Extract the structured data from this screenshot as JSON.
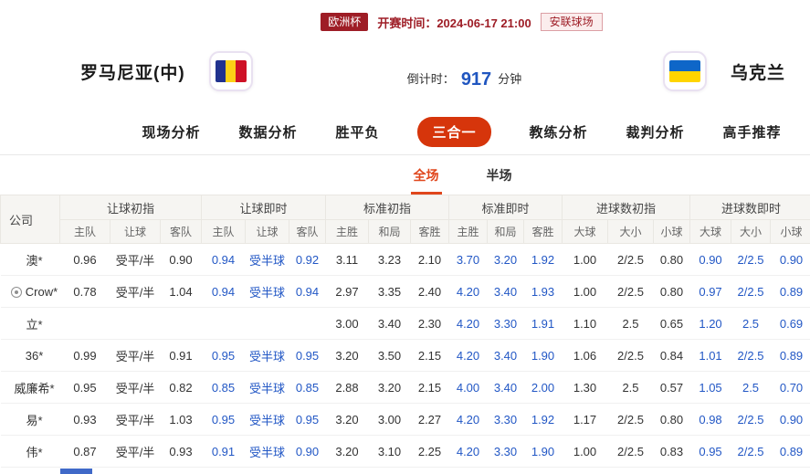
{
  "colors": {
    "accent": "#9e1d26",
    "tab_active": "#d6350b",
    "live_blue": "#2257c5",
    "countdown_blue": "#2056c0",
    "subtab_red": "#e0461c"
  },
  "header": {
    "league": "欧洲杯",
    "kickoff_label": "开赛时间：2024-06-17 21:00",
    "venue": "安联球场"
  },
  "teams": {
    "home": "罗马尼亚(中)",
    "away": "乌克兰",
    "home_flag": {
      "name": "romania-flag",
      "type": "vertical",
      "colors": [
        "#21328f",
        "#fcd116",
        "#ce1126"
      ]
    },
    "away_flag": {
      "name": "ukraine-flag",
      "type": "horizontal",
      "colors": [
        "#0e66c8",
        "#ffd500"
      ]
    },
    "countdown_label": "倒计时：",
    "countdown_value": "917",
    "countdown_unit": "分钟"
  },
  "nav": {
    "tabs": [
      {
        "name": "live-analysis",
        "label": "现场分析",
        "active": false
      },
      {
        "name": "data-analysis",
        "label": "数据分析",
        "active": false
      },
      {
        "name": "win-draw-loss",
        "label": "胜平负",
        "active": false
      },
      {
        "name": "three-in-one",
        "label": "三合一",
        "active": true
      },
      {
        "name": "coach-analysis",
        "label": "教练分析",
        "active": false
      },
      {
        "name": "referee-analysis",
        "label": "裁判分析",
        "active": false
      },
      {
        "name": "expert-picks",
        "label": "高手推荐",
        "active": false
      }
    ]
  },
  "subtabs": [
    {
      "name": "full-match",
      "label": "全场",
      "active": true
    },
    {
      "name": "half-match",
      "label": "半场",
      "active": false
    }
  ],
  "table": {
    "company_header": "公司",
    "groups": [
      {
        "name": "handicap-initial",
        "label": "让球初指",
        "live": false,
        "cols": [
          "主队",
          "让球",
          "客队"
        ]
      },
      {
        "name": "handicap-live",
        "label": "让球即时",
        "live": true,
        "cols": [
          "主队",
          "让球",
          "客队"
        ]
      },
      {
        "name": "1x2-initial",
        "label": "标准初指",
        "live": false,
        "cols": [
          "主胜",
          "和局",
          "客胜"
        ]
      },
      {
        "name": "1x2-live",
        "label": "标准即时",
        "live": true,
        "cols": [
          "主胜",
          "和局",
          "客胜"
        ]
      },
      {
        "name": "goals-initial",
        "label": "进球数初指",
        "live": false,
        "cols": [
          "大球",
          "大小",
          "小球"
        ]
      },
      {
        "name": "goals-live",
        "label": "进球数即时",
        "live": true,
        "cols": [
          "大球",
          "大小",
          "小球"
        ]
      }
    ],
    "rows": [
      {
        "company": "澳*",
        "icon": "",
        "cells": [
          "0.96",
          "受平/半",
          "0.90",
          "0.94",
          "受半球",
          "0.92",
          "3.11",
          "3.23",
          "2.10",
          "3.70",
          "3.20",
          "1.92",
          "1.00",
          "2/2.5",
          "0.80",
          "0.90",
          "2/2.5",
          "0.90"
        ]
      },
      {
        "company": "Crow*",
        "icon": "circle-dot-icon",
        "cells": [
          "0.78",
          "受平/半",
          "1.04",
          "0.94",
          "受半球",
          "0.94",
          "2.97",
          "3.35",
          "2.40",
          "4.20",
          "3.40",
          "1.93",
          "1.00",
          "2/2.5",
          "0.80",
          "0.97",
          "2/2.5",
          "0.89"
        ]
      },
      {
        "company": "立*",
        "icon": "",
        "cells": [
          "",
          "",
          "",
          "",
          "",
          "",
          "3.00",
          "3.40",
          "2.30",
          "4.20",
          "3.30",
          "1.91",
          "1.10",
          "2.5",
          "0.65",
          "1.20",
          "2.5",
          "0.69"
        ]
      },
      {
        "company": "36*",
        "icon": "",
        "cells": [
          "0.99",
          "受平/半",
          "0.91",
          "0.95",
          "受半球",
          "0.95",
          "3.20",
          "3.50",
          "2.15",
          "4.20",
          "3.40",
          "1.90",
          "1.06",
          "2/2.5",
          "0.84",
          "1.01",
          "2/2.5",
          "0.89"
        ]
      },
      {
        "company": "威廉希*",
        "icon": "",
        "cells": [
          "0.95",
          "受平/半",
          "0.82",
          "0.85",
          "受半球",
          "0.85",
          "2.88",
          "3.20",
          "2.15",
          "4.00",
          "3.40",
          "2.00",
          "1.30",
          "2.5",
          "0.57",
          "1.05",
          "2.5",
          "0.70"
        ]
      },
      {
        "company": "易*",
        "icon": "",
        "cells": [
          "0.93",
          "受平/半",
          "1.03",
          "0.95",
          "受半球",
          "0.95",
          "3.20",
          "3.00",
          "2.27",
          "4.20",
          "3.30",
          "1.92",
          "1.17",
          "2/2.5",
          "0.80",
          "0.98",
          "2/2.5",
          "0.90"
        ]
      },
      {
        "company": "伟*",
        "icon": "",
        "cells": [
          "0.87",
          "受平/半",
          "0.93",
          "0.91",
          "受半球",
          "0.90",
          "3.20",
          "3.10",
          "2.25",
          "4.20",
          "3.30",
          "1.90",
          "1.00",
          "2/2.5",
          "0.83",
          "0.95",
          "2/2.5",
          "0.89"
        ]
      }
    ]
  }
}
